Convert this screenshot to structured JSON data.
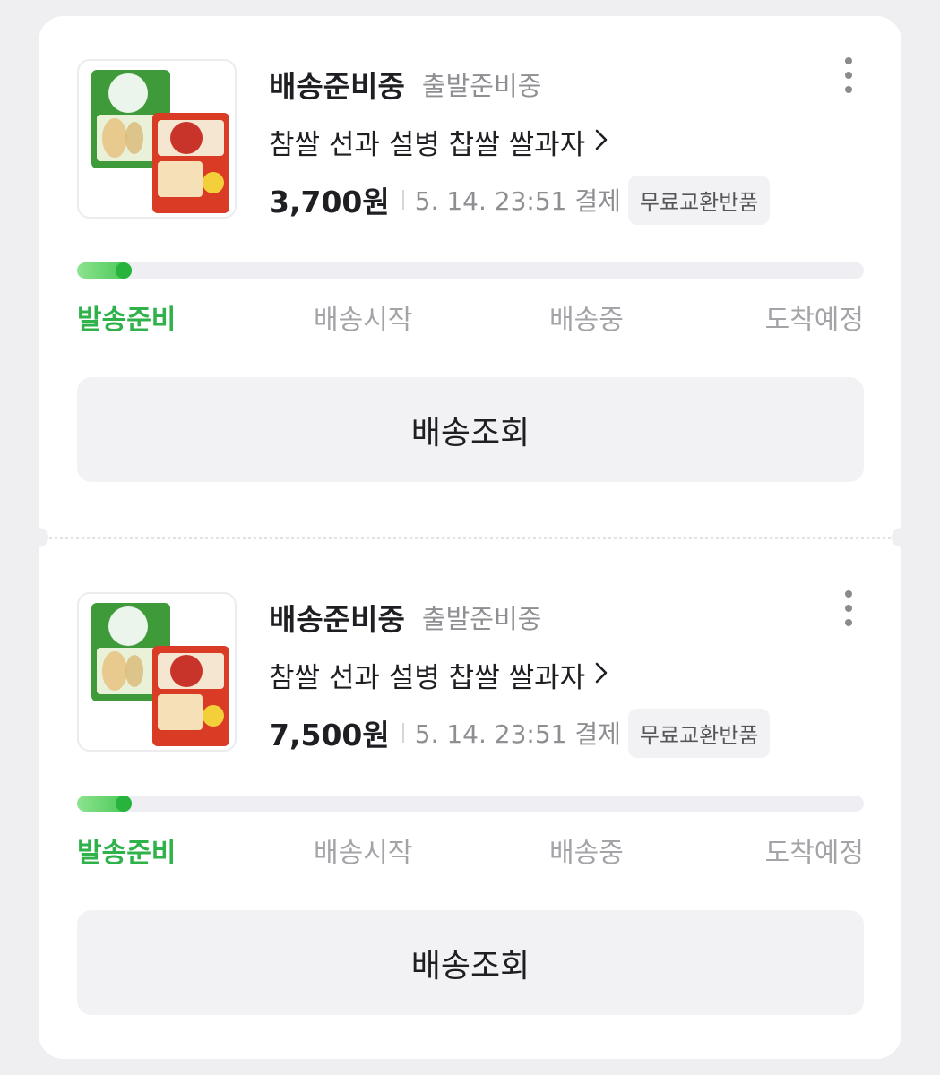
{
  "colors": {
    "page_bg": "#efeff2",
    "accent_green": "#2fb24a",
    "muted_text": "#8e8e93"
  },
  "orders": [
    {
      "status": "배송준비중",
      "sub_status": "출발준비중",
      "product_name": "참쌀 선과 설병 찹쌀 쌀과자",
      "price": "3,700원",
      "payment_info": "5. 14. 23:51 결제",
      "badge": "무료교환반품",
      "progress_fraction": 0.07,
      "steps": [
        "발송준비",
        "배송시작",
        "배송중",
        "도착예정"
      ],
      "active_step": 0,
      "track_button": "배송조회",
      "more_icon": "more-vertical-icon"
    },
    {
      "status": "배송준비중",
      "sub_status": "출발준비중",
      "product_name": "참쌀 선과 설병 찹쌀 쌀과자",
      "price": "7,500원",
      "payment_info": "5. 14. 23:51 결제",
      "badge": "무료교환반품",
      "progress_fraction": 0.07,
      "steps": [
        "발송준비",
        "배송시작",
        "배송중",
        "도착예정"
      ],
      "active_step": 0,
      "track_button": "배송조회",
      "more_icon": "more-vertical-icon"
    }
  ]
}
